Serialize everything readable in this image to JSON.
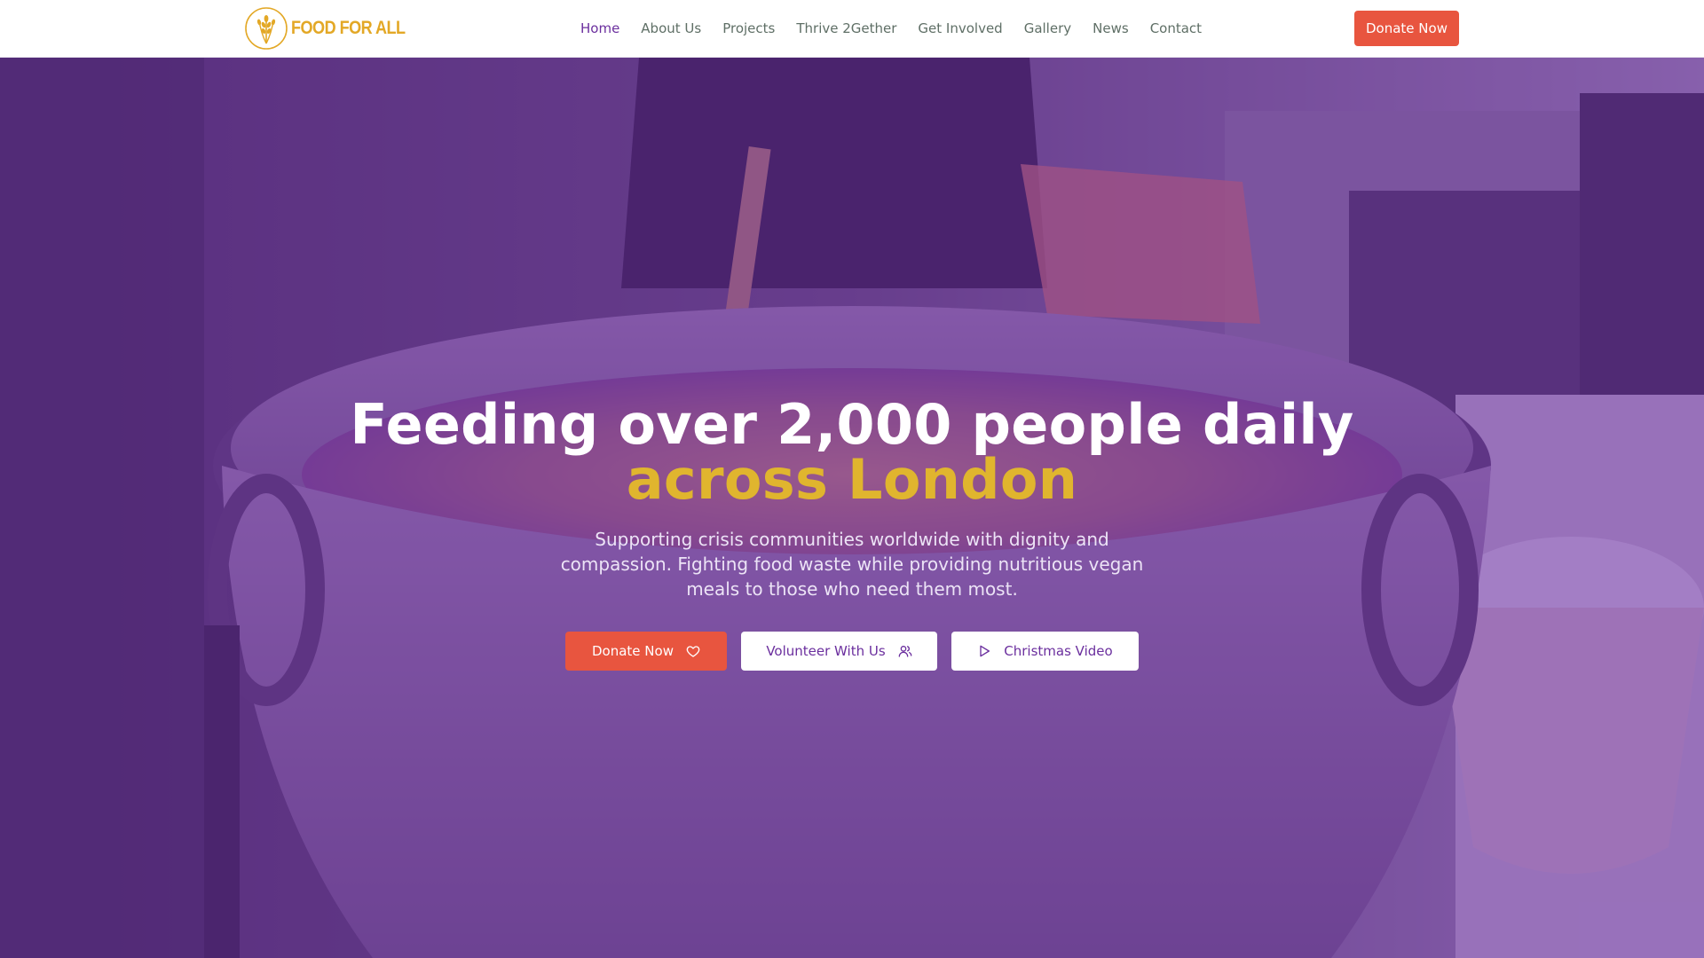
{
  "header": {
    "logo_text": "FOOD FOR ALL",
    "donate_label": "Donate Now"
  },
  "nav": {
    "items": [
      {
        "label": "Home",
        "active": true
      },
      {
        "label": "About Us"
      },
      {
        "label": "Projects"
      },
      {
        "label": "Thrive 2Gether"
      },
      {
        "label": "Get Involved"
      },
      {
        "label": "Gallery"
      },
      {
        "label": "News"
      },
      {
        "label": "Contact"
      }
    ]
  },
  "hero": {
    "title_line1": "Feeding over 2,000 people daily",
    "title_line2": "across London",
    "subtitle": "Supporting crisis communities worldwide with dignity and compassion. Fighting food waste while providing nutritious vegan meals to those who need them most.",
    "buttons": {
      "donate": {
        "label": "Donate Now",
        "icon": "heart-icon"
      },
      "volunteer": {
        "label": "Volunteer With Us",
        "icon": "users-icon"
      },
      "video": {
        "label": "Christmas Video",
        "icon": "play-icon"
      }
    }
  },
  "colors": {
    "brand_purple": "#6b2f9e",
    "accent_gold": "#e0b52e",
    "cta_orange": "#e8553f",
    "logo_gold": "#e3a826"
  }
}
